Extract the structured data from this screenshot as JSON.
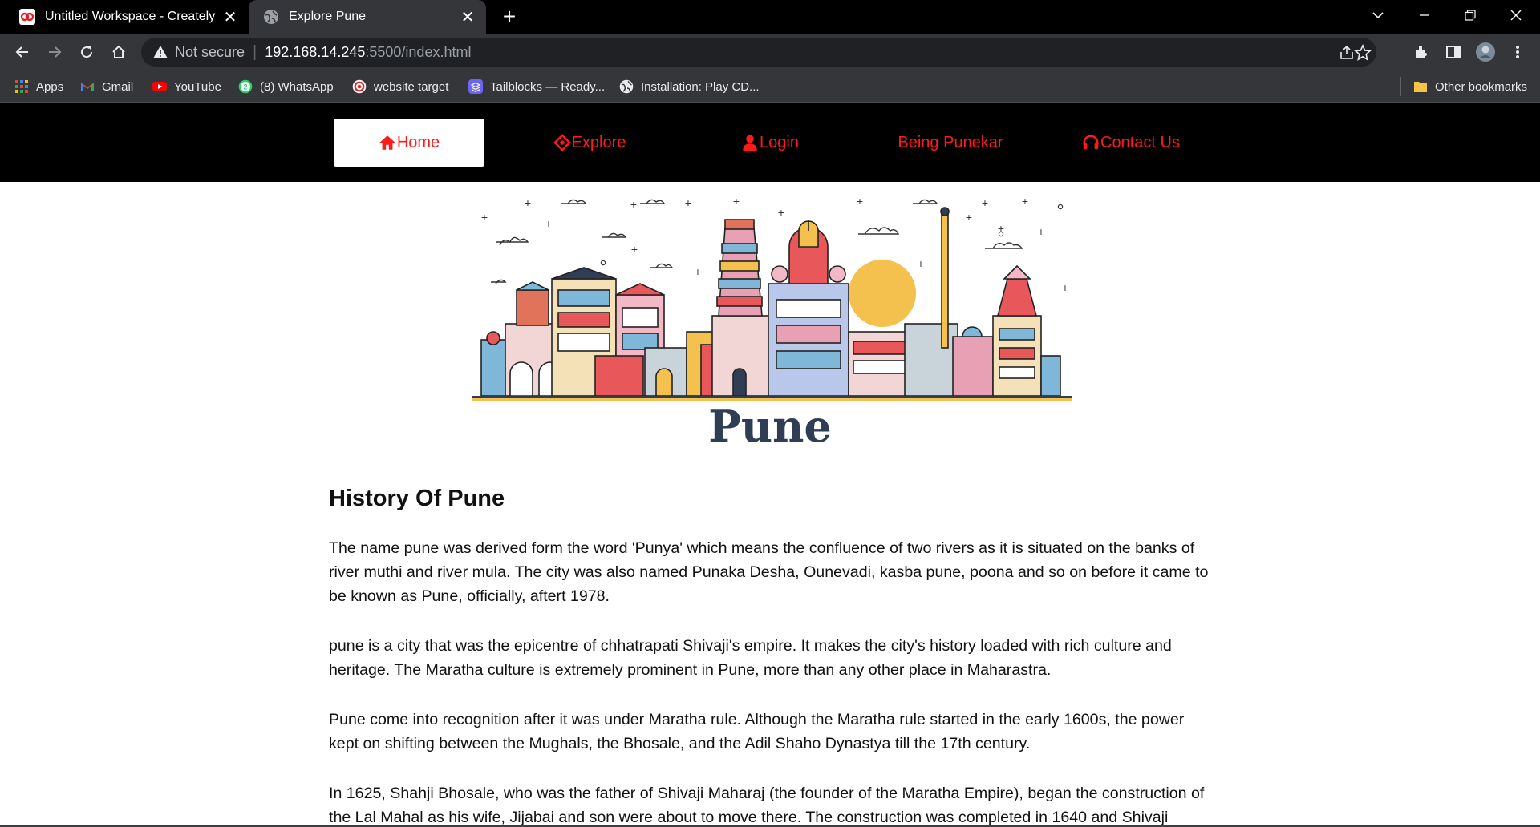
{
  "browser": {
    "tabs": [
      {
        "title": "Untitled Workspace - Creately",
        "favicon": "creately-icon",
        "active": false
      },
      {
        "title": "Explore Pune",
        "favicon": "globe-icon",
        "active": true
      }
    ],
    "address": {
      "security_label": "Not secure",
      "host": "192.168.14.245",
      "path": ":5500/index.html"
    },
    "bookmarks": [
      {
        "label": "Apps",
        "icon": "apps-grid-icon"
      },
      {
        "label": "Gmail",
        "icon": "gmail-icon"
      },
      {
        "label": "YouTube",
        "icon": "youtube-icon"
      },
      {
        "label": "(8) WhatsApp",
        "icon": "whatsapp-icon"
      },
      {
        "label": "website target",
        "icon": "target-icon"
      },
      {
        "label": "Tailblocks — Ready...",
        "icon": "tailblocks-icon"
      },
      {
        "label": "Installation: Play CD...",
        "icon": "globe-icon"
      }
    ],
    "other_bookmarks": "Other bookmarks"
  },
  "site": {
    "nav": [
      {
        "label": "Home",
        "icon": "home-icon",
        "active": true
      },
      {
        "label": "Explore",
        "icon": "compass-icon",
        "active": false
      },
      {
        "label": "Login",
        "icon": "user-icon",
        "active": false
      },
      {
        "label": "Being Punekar",
        "icon": "",
        "active": false
      },
      {
        "label": "Contact Us",
        "icon": "headset-icon",
        "active": false
      }
    ],
    "accent_color": "#ff1a1a",
    "hero_title": "Pune",
    "section_title": "History Of Pune",
    "paragraphs": [
      "The name pune was derived form the word 'Punya' which means the confluence of two rivers as it is situated on the banks of river muthi and river mula. The city was also named Punaka Desha, Ounevadi, kasba pune, poona and so on before it came to be known as Pune, officially, aftert 1978.",
      "pune is a city that was the epicentre of chhatrapati Shivaji's empire. It makes the city's history loaded with rich culture and heritage. The Maratha culture is extremely prominent in Pune, more than any other place in Maharastra.",
      "Pune come into recognition after it was under Maratha rule. Although the Maratha rule started in the early 1600s, the power kept on shifting between the Mughals, the Bhosale, and the Adil Shaho Dynastya till the 17th century.",
      "In 1625, Shahji Bhosale, who was the father of Shivaji Maharaj (the founder of the Maratha Empire), began the construction of the Lal Mahal as his wife, Jijabai and son were about to move there. The construction was completed in 1640 and Shivaji"
    ]
  }
}
